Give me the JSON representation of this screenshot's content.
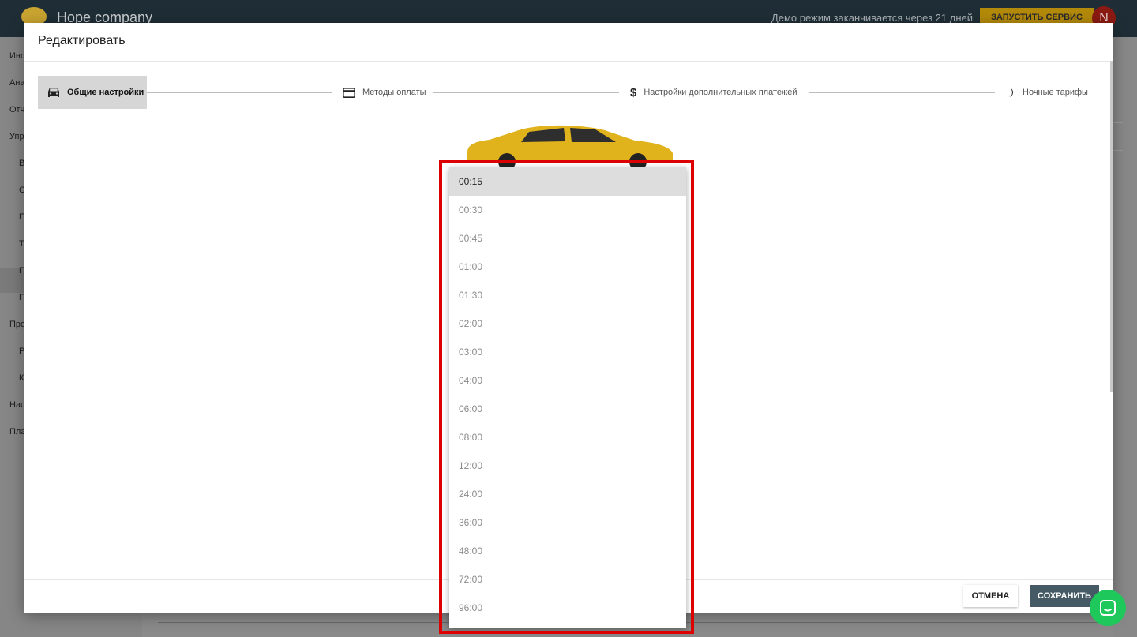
{
  "topbar": {
    "company": "Hope company",
    "demo_notice": "Демо режим заканчивается через 21 дней",
    "run_service": "ЗАПУСТИТЬ СЕРВИС",
    "avatar_initial": "N"
  },
  "sidebar": {
    "items": [
      "Инф",
      "Ана",
      "Отч",
      "Упр",
      "В",
      "С",
      "П",
      "Т",
      "П",
      "П",
      "Про",
      "Р",
      "К",
      "Нас",
      "Пла"
    ]
  },
  "modal": {
    "title": "Редактировать",
    "steps": [
      {
        "label": "Общие настройки",
        "icon": "car-icon",
        "active": true
      },
      {
        "label": "Методы оплаты",
        "icon": "credit-card-icon",
        "active": false
      },
      {
        "label": "Настройки дополнительных платежей",
        "icon": "dollar-icon",
        "active": false
      },
      {
        "label": "Ночные тарифы",
        "icon": "moon-icon",
        "active": false
      }
    ],
    "cancel_label": "ОТМЕНА",
    "save_label": "СОХРАНИТЬ"
  },
  "dropdown": {
    "selected": "00:15",
    "options": [
      "00:15",
      "00:30",
      "00:45",
      "01:00",
      "01:30",
      "02:00",
      "03:00",
      "04:00",
      "06:00",
      "08:00",
      "12:00",
      "24:00",
      "36:00",
      "48:00",
      "72:00",
      "96:00"
    ]
  },
  "colors": {
    "topbar": "#1f2e36",
    "accent": "#b48a0a",
    "save_button": "#455a64",
    "highlight": "#dd0000",
    "chat": "#1ec85a"
  }
}
